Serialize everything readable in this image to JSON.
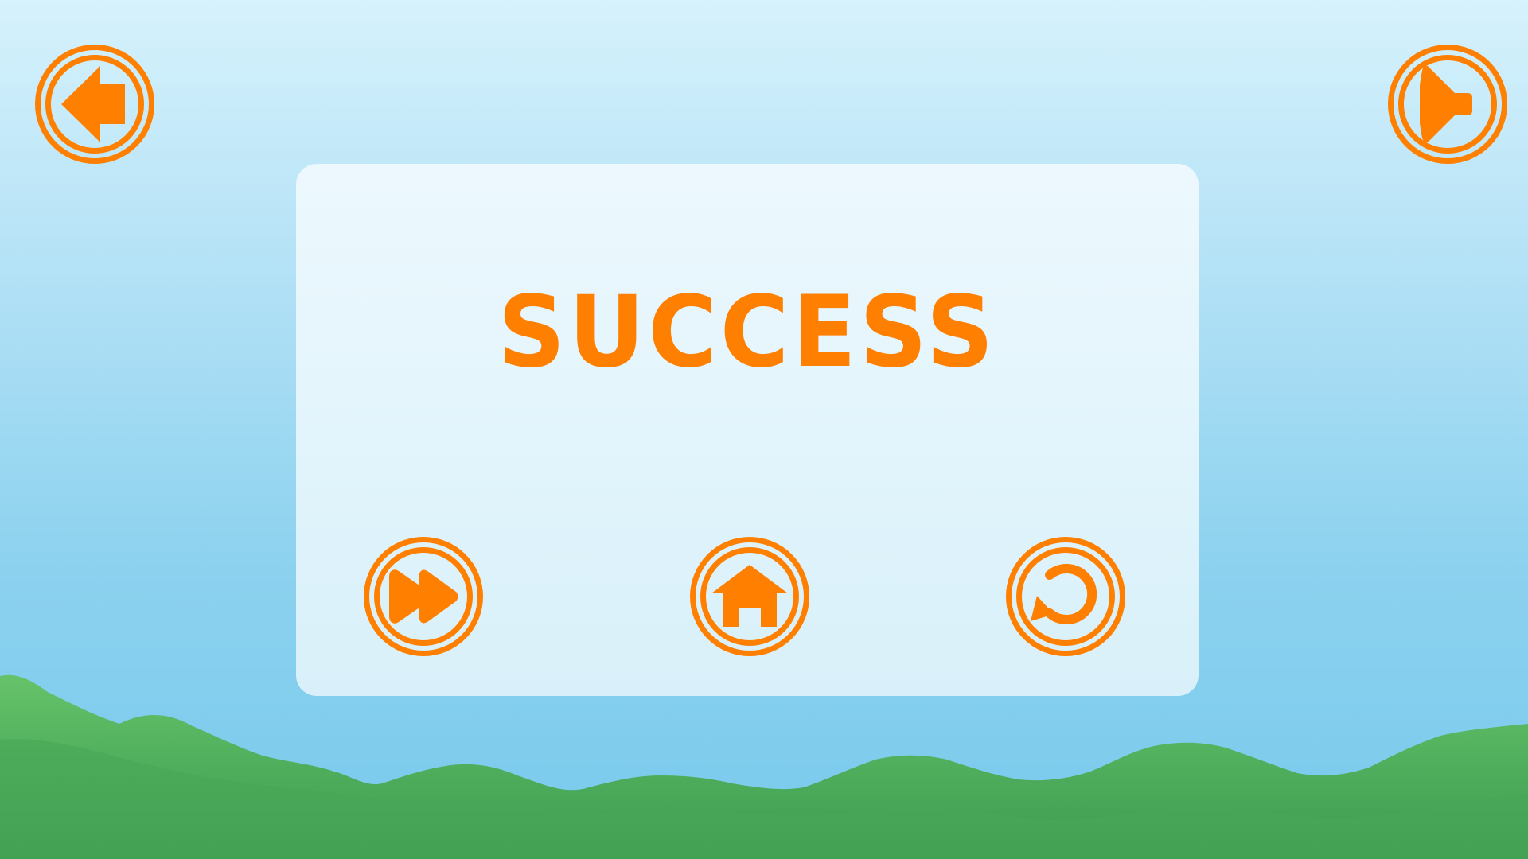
{
  "screen": {
    "title": "SUCCESS"
  },
  "buttons": {
    "back": {
      "icon": "arrow-left-icon"
    },
    "sound": {
      "icon": "speaker-icon"
    },
    "next": {
      "icon": "fast-forward-icon"
    },
    "home": {
      "icon": "home-icon"
    },
    "replay": {
      "icon": "replay-icon"
    }
  },
  "colors": {
    "accent": "#ff7f00",
    "sky_top": "#d6f2fc",
    "sky_bottom": "#78c9ec",
    "bush_light": "#5fbf63",
    "bush_dark": "#3f9a4f"
  }
}
